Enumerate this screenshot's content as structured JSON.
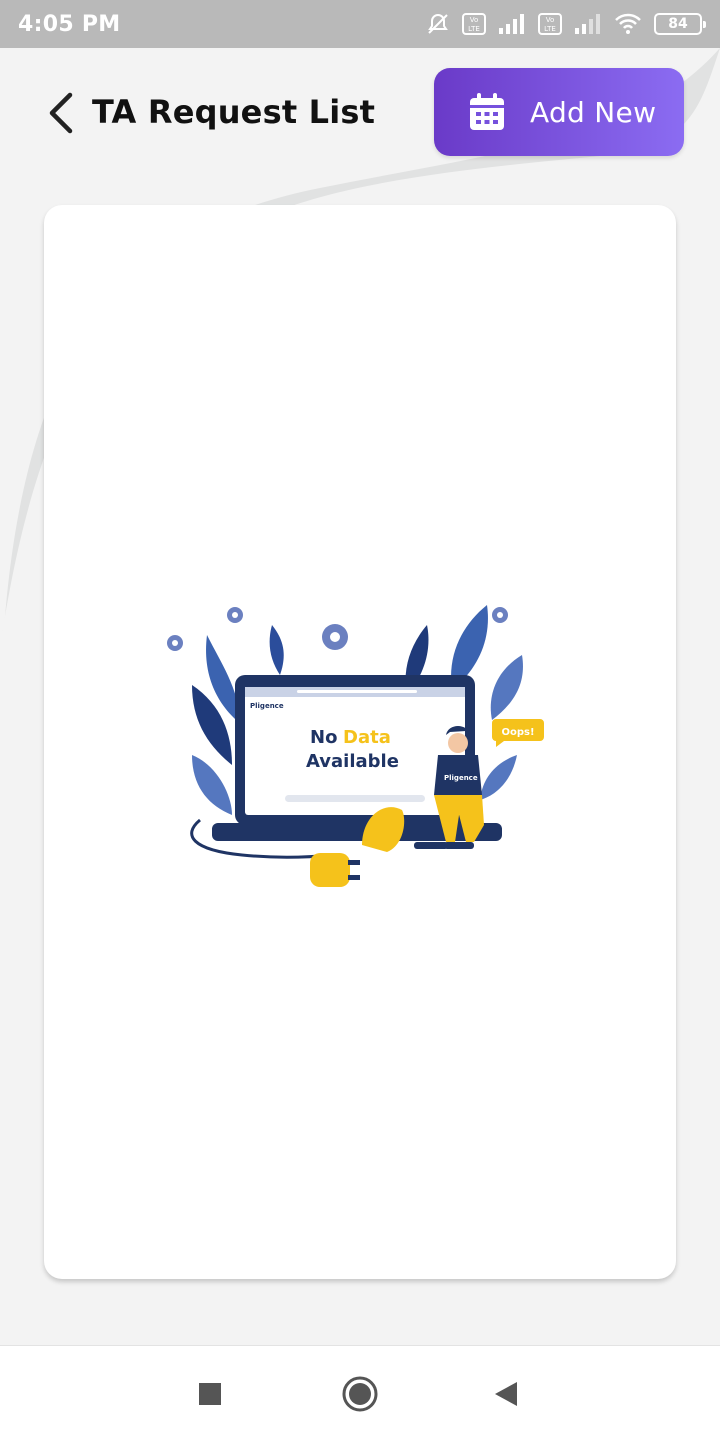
{
  "status_bar": {
    "time": "4:05 PM",
    "battery": "84",
    "icons": [
      "mute-alarm-icon",
      "volte-icon",
      "signal-icon",
      "volte-icon",
      "signal-icon",
      "wifi-icon",
      "battery-icon"
    ]
  },
  "header": {
    "title": "TA Request List",
    "back_icon": "chevron-left-icon",
    "add_button_label": "Add New",
    "add_button_icon": "calendar-icon"
  },
  "empty_state": {
    "line1_a": "No",
    "line1_b": "Data",
    "line2": "Available",
    "bubble": "Oops!",
    "brand": "Pligence"
  },
  "nav_bar": {
    "icons": [
      "recents-square-icon",
      "home-circle-icon",
      "back-triangle-icon"
    ]
  },
  "colors": {
    "accent_start": "#6a3ac8",
    "accent_end": "#8b6cf2",
    "navy": "#1f3464",
    "yellow": "#f5c21b"
  }
}
